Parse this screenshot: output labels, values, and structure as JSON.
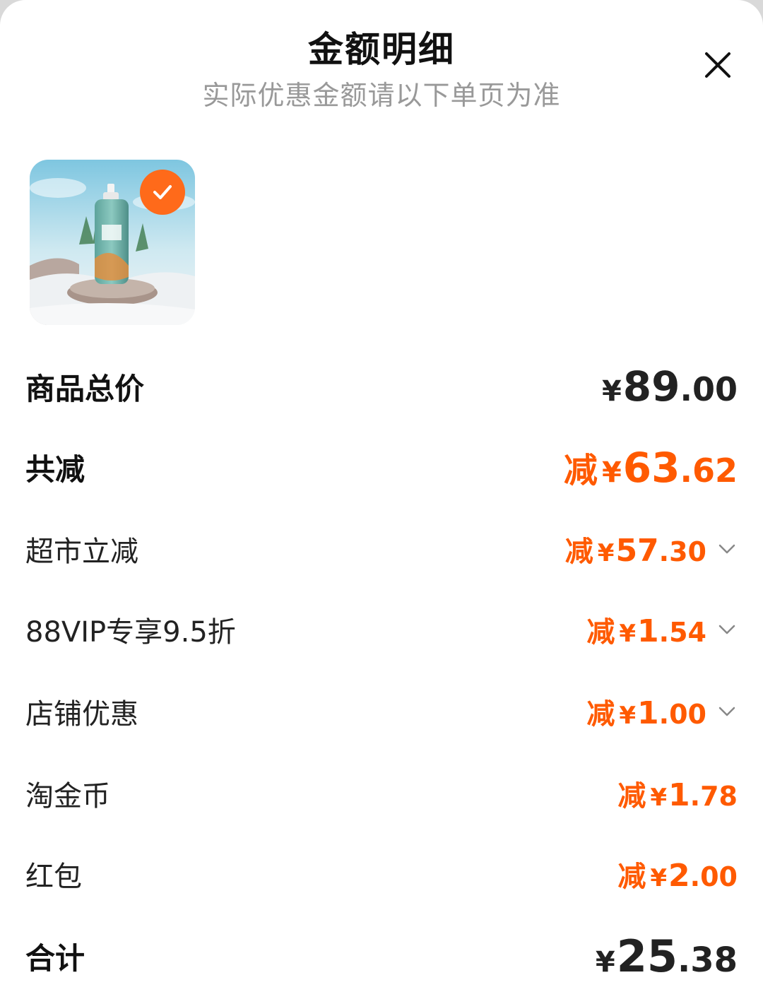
{
  "header": {
    "title": "金额明细",
    "subtitle": "实际优惠金额请以下单页为准"
  },
  "icons": {
    "close": "close-icon",
    "check": "check-icon",
    "chevron": "chevron-down-icon"
  },
  "colors": {
    "accent": "#ff5a00",
    "badge": "#ff6a1a",
    "text_dark": "#222222",
    "text_muted": "#999999"
  },
  "summary": {
    "total_price": {
      "label": "商品总价",
      "currency": "¥",
      "int": "89",
      "dec": ".00"
    },
    "total_discount": {
      "label": "共减",
      "prefix": "减",
      "currency": "¥",
      "int": "63",
      "dec": ".62"
    },
    "grand_total": {
      "label": "合计",
      "currency": "¥",
      "int": "25",
      "dec": ".38"
    }
  },
  "discounts": [
    {
      "label": "超市立减",
      "prefix": "减",
      "currency": "¥",
      "int": "57",
      "dec": ".30",
      "expandable": true
    },
    {
      "label": "88VIP专享9.5折",
      "prefix": "减",
      "currency": "¥",
      "int": "1",
      "dec": ".54",
      "expandable": true
    },
    {
      "label": "店铺优惠",
      "prefix": "减",
      "currency": "¥",
      "int": "1",
      "dec": ".00",
      "expandable": true
    },
    {
      "label": "淘金币",
      "prefix": "减",
      "currency": "¥",
      "int": "1",
      "dec": ".78",
      "expandable": false
    },
    {
      "label": "红包",
      "prefix": "减",
      "currency": "¥",
      "int": "2",
      "dec": ".00",
      "expandable": false
    }
  ]
}
